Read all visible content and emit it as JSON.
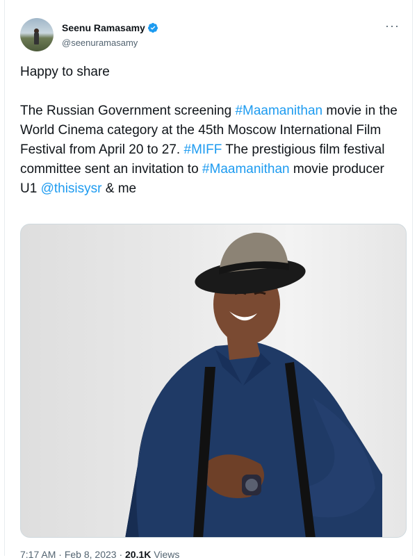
{
  "author": {
    "display_name": "Seenu Ramasamy",
    "handle": "@seenuramasamy",
    "verified": true
  },
  "more_menu_icon": "more-horizontal-icon",
  "tweet": {
    "line1": "Happy to share",
    "segments": [
      {
        "text": "The Russian Government screening ",
        "type": "text"
      },
      {
        "text": "#Maamanithan",
        "type": "hashtag"
      },
      {
        "text": " movie in the World Cinema category at the 45th Moscow International Film Festival from April 20 to 27. ",
        "type": "text"
      },
      {
        "text": "#MIFF",
        "type": "hashtag"
      },
      {
        "text": " The prestigious film festival committee sent an invitation to ",
        "type": "text"
      },
      {
        "text": "#Maamanithan",
        "type": "hashtag"
      },
      {
        "text": " movie producer U1 ",
        "type": "text"
      },
      {
        "text": "@thisisysr",
        "type": "mention"
      },
      {
        "text": " & me",
        "type": "text"
      }
    ]
  },
  "footer": {
    "time": "7:17 AM",
    "date": "Feb 8, 2023",
    "views_count": "20.1K",
    "views_label": "Views"
  },
  "colors": {
    "link": "#1d9bf0",
    "verified_badge": "#1d9bf0",
    "secondary_text": "#536471"
  }
}
